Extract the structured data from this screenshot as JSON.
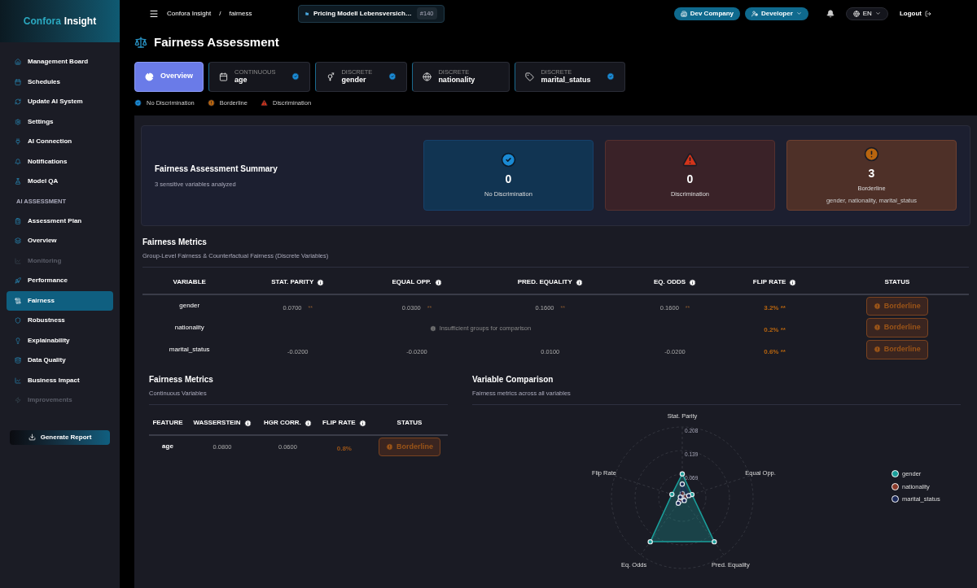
{
  "brand": {
    "part_1": "Confora",
    "part_2": "Insight"
  },
  "sidebar": {
    "items": [
      {
        "kind": "link",
        "label": "Management Board",
        "selected": false,
        "disabled": false
      },
      {
        "kind": "link",
        "label": "Schedules",
        "selected": false,
        "disabled": false
      },
      {
        "kind": "link",
        "label": "Update AI System",
        "selected": false,
        "disabled": false
      },
      {
        "kind": "link",
        "label": "Settings",
        "selected": false,
        "disabled": false
      },
      {
        "kind": "link",
        "label": "AI Connection",
        "selected": false,
        "disabled": false
      },
      {
        "kind": "link",
        "label": "Notifications",
        "selected": false,
        "disabled": false
      },
      {
        "kind": "link",
        "label": "Model QA",
        "selected": false,
        "disabled": false
      },
      {
        "kind": "heading",
        "label": "AI ASSESSMENT"
      },
      {
        "kind": "link",
        "label": "Assessment Plan",
        "selected": false,
        "disabled": false
      },
      {
        "kind": "link",
        "label": "Overview",
        "selected": false,
        "disabled": false
      },
      {
        "kind": "link",
        "label": "Monitoring",
        "selected": false,
        "disabled": true
      },
      {
        "kind": "link",
        "label": "Performance",
        "selected": false,
        "disabled": false
      },
      {
        "kind": "link",
        "label": "Fairness",
        "selected": true,
        "disabled": false
      },
      {
        "kind": "link",
        "label": "Robustness",
        "selected": false,
        "disabled": false
      },
      {
        "kind": "link",
        "label": "Explainability",
        "selected": false,
        "disabled": false
      },
      {
        "kind": "link",
        "label": "Data Quality",
        "selected": false,
        "disabled": false
      },
      {
        "kind": "link",
        "label": "Business Impact",
        "selected": false,
        "disabled": false
      },
      {
        "kind": "link",
        "label": "Improvements",
        "selected": false,
        "disabled": true
      }
    ],
    "button": "Generate Report"
  },
  "topbar": {
    "breadcrumb": [
      "Confora Insight",
      "/",
      "fairness"
    ],
    "project": "Pricing Modell Lebensversich…",
    "project_id": "#140",
    "company": "Dev Company",
    "role": "Developer",
    "language": "EN",
    "logout": "Logout"
  },
  "page_title": "Fairness Assessment",
  "tabs": [
    {
      "kind": "overview",
      "label": "Overview",
      "selected": true
    },
    {
      "kind": "variable",
      "type": "CONTINUOUS",
      "label": "age",
      "selected": false,
      "checked": true
    },
    {
      "kind": "variable",
      "type": "DISCRETE",
      "label": "gender",
      "selected": false,
      "checked": true
    },
    {
      "kind": "variable",
      "type": "DISCRETE",
      "label": "nationality",
      "selected": false,
      "checked": false
    },
    {
      "kind": "variable",
      "type": "DISCRETE",
      "label": "marital_status",
      "selected": false,
      "checked": true
    }
  ],
  "legend": [
    {
      "kind": "ok",
      "label": "No Discrimination"
    },
    {
      "kind": "warn",
      "label": "Borderline"
    },
    {
      "kind": "bad",
      "label": "Discrimination"
    }
  ],
  "summary": {
    "title": "Fairness Assessment Summary",
    "subtitle": "3 sensitive variables analyzed",
    "cards": [
      {
        "kind": "ok",
        "count": "0",
        "label": "No Discrimination"
      },
      {
        "kind": "bad",
        "count": "0",
        "label": "Discrimination"
      },
      {
        "kind": "warn",
        "count": "3",
        "label": "Borderline",
        "detail": "gender, nationality, marital_status"
      }
    ]
  },
  "discrete": {
    "title": "Fairness Metrics",
    "subtitle": "Group-Level Fairness & Counterfactual Fairness (Discrete Variables)",
    "columns": [
      "VARIABLE",
      "STAT. PARITY",
      "EQUAL OPP.",
      "PRED. EQUALITY",
      "EQ. ODDS",
      "FLIP RATE",
      "STATUS"
    ],
    "rows": [
      {
        "variable": "gender",
        "cells": [
          {
            "value": "0.0700",
            "mark": "**"
          },
          {
            "value": "0.0300",
            "mark": "**"
          },
          {
            "value": "0.1600",
            "mark": "**"
          },
          {
            "value": "0.1600",
            "mark": "**"
          }
        ],
        "flip_rate": "3.2% **",
        "status": "Borderline"
      },
      {
        "variable": "nationality",
        "note": "Insufficient groups for comparison",
        "flip_rate": "0.2% **",
        "status": "Borderline"
      },
      {
        "variable": "marital_status",
        "cells": [
          {
            "value": "-0.0200"
          },
          {
            "value": "-0.0200"
          },
          {
            "value": "0.0100"
          },
          {
            "value": "-0.0200"
          }
        ],
        "flip_rate": "0.6% **",
        "status": "Borderline"
      }
    ]
  },
  "continuous": {
    "title": "Fairness Metrics",
    "subtitle": "Continuous Variables",
    "columns": [
      "FEATURE",
      "WASSERSTEIN",
      "HGR CORR.",
      "FLIP RATE",
      "STATUS"
    ],
    "rows": [
      {
        "feature": "age",
        "wasserstein": "0.0800",
        "hgr_corr": "0.0600",
        "flip_rate": "0.8%",
        "status": "Borderline"
      }
    ]
  },
  "comparison": {
    "title": "Variable Comparison",
    "subtitle": "Fairness metrics across all variables",
    "axes": [
      "Stat. Parity",
      "Equal Opp.",
      "Pred. Equality",
      "Eq. Odds",
      "Flip Rate"
    ],
    "ticks": [
      "0.208",
      "0.139",
      "0.069"
    ],
    "legend": [
      {
        "label": "gender",
        "color": "#1a9e9a"
      },
      {
        "label": "nationality",
        "color": "#8a3a2a"
      },
      {
        "label": "marital_status",
        "color": "#1c2a5a"
      }
    ]
  }
}
